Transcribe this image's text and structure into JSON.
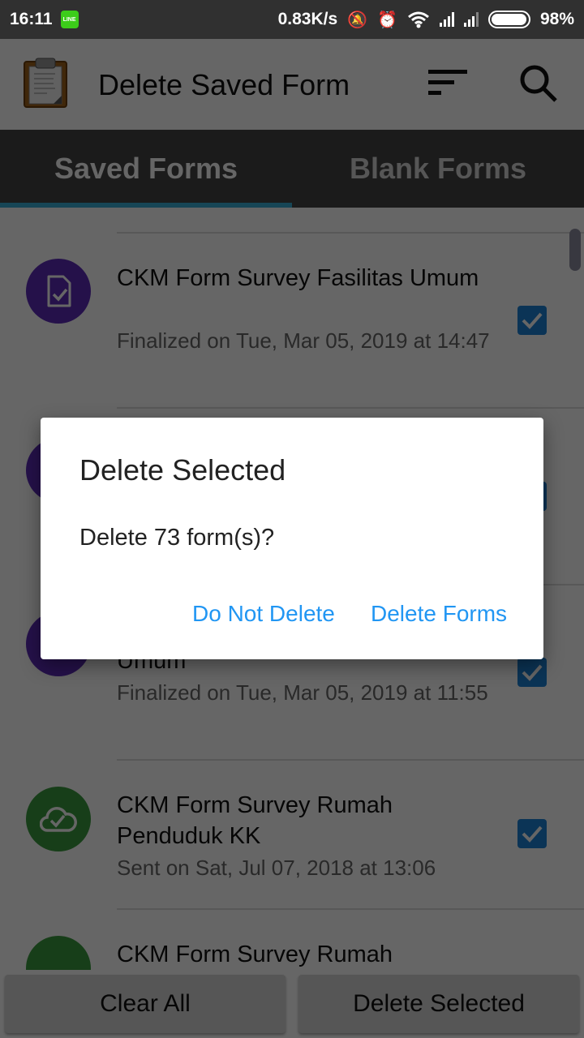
{
  "status_bar": {
    "time": "16:11",
    "notification_app": "LINE",
    "network_speed": "0.83K/s",
    "icons": [
      "vibrate-off-icon",
      "alarm-icon",
      "wifi-icon",
      "signal-icon",
      "signal-icon"
    ],
    "battery_percent": "98%",
    "battery_level": 0.98
  },
  "app_bar": {
    "title": "Delete Saved Form",
    "logo": "clipboard-icon",
    "actions": [
      "sort-icon",
      "search-icon"
    ]
  },
  "tabs": [
    {
      "label": "Saved Forms",
      "active": true
    },
    {
      "label": "Blank Forms",
      "active": false
    }
  ],
  "list": {
    "items": [
      {
        "title": "CKM Form Survey Fasilitas Umum",
        "subtitle": "Finalized on Tue, Mar 05, 2019 at 14:47",
        "status_icon": "finalized-form-icon",
        "checked": true
      },
      {
        "title": "",
        "subtitle": "",
        "status_icon": "finalized-form-icon",
        "checked": true
      },
      {
        "title": "Umum",
        "subtitle": "Finalized on Tue, Mar 05, 2019 at 11:55",
        "status_icon": "finalized-form-icon",
        "checked": true
      },
      {
        "title": "CKM Form Survey Rumah Penduduk KK",
        "subtitle": "Sent on Sat, Jul 07, 2018 at 13:06",
        "status_icon": "sent-cloud-icon",
        "checked": true
      },
      {
        "title": "CKM Form Survey Rumah",
        "subtitle": "",
        "status_icon": "sent-cloud-icon",
        "checked": false
      }
    ]
  },
  "bottom_bar": {
    "clear_all_label": "Clear All",
    "delete_selected_label": "Delete Selected"
  },
  "dialog": {
    "title": "Delete Selected",
    "message": "Delete 73 form(s)?",
    "cancel_label": "Do Not Delete",
    "confirm_label": "Delete Forms"
  },
  "colors": {
    "accent": "#2196f3",
    "checkbox": "#1c82d6",
    "finalized": "#5c2cb8",
    "sent": "#3b9b3f",
    "tab_indicator": "#3aaed8"
  }
}
